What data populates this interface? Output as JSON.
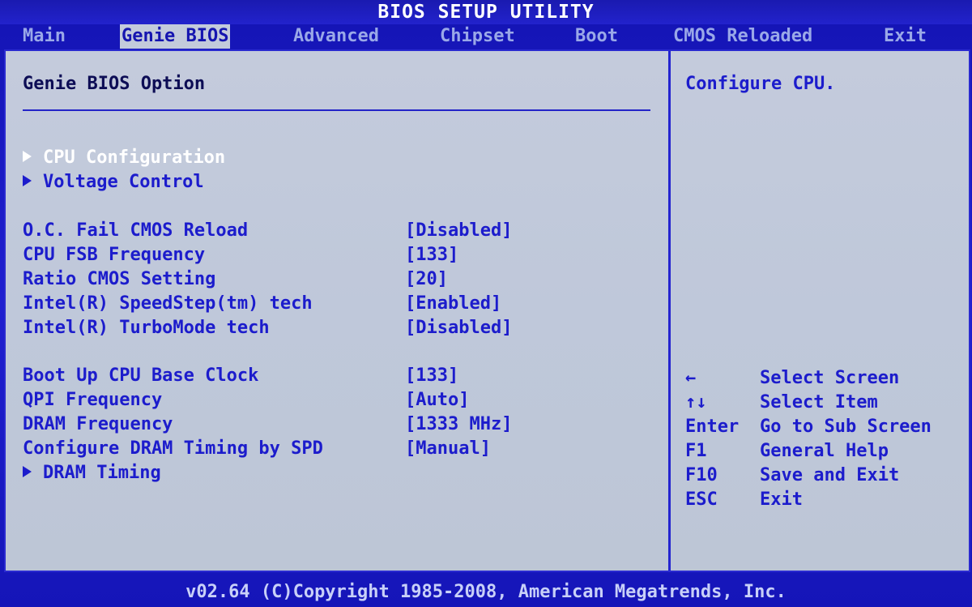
{
  "title": "BIOS SETUP UTILITY",
  "tabs": [
    {
      "label": "Main",
      "active": false
    },
    {
      "label": "Genie BIOS",
      "active": true
    },
    {
      "label": "Advanced",
      "active": false
    },
    {
      "label": "Chipset",
      "active": false
    },
    {
      "label": "Boot",
      "active": false
    },
    {
      "label": "CMOS Reloaded",
      "active": false
    },
    {
      "label": "Exit",
      "active": false
    }
  ],
  "section_title": "Genie BIOS Option",
  "submenus": [
    {
      "label": "CPU Configuration",
      "selected": true,
      "icon": "right-triangle-icon"
    },
    {
      "label": "Voltage Control",
      "selected": false,
      "icon": "right-triangle-icon"
    }
  ],
  "settings_group1": [
    {
      "label": "O.C. Fail CMOS Reload",
      "value": "[Disabled]"
    },
    {
      "label": "CPU FSB Frequency",
      "value": "[133]"
    },
    {
      "label": "Ratio CMOS Setting",
      "value": "[20]"
    },
    {
      "label": "Intel(R) SpeedStep(tm) tech",
      "value": "[Enabled]"
    },
    {
      "label": "Intel(R) TurboMode tech",
      "value": "[Disabled]"
    }
  ],
  "settings_group2": [
    {
      "label": "Boot Up CPU Base Clock",
      "value": "[133]"
    },
    {
      "label": "QPI Frequency",
      "value": "[Auto]"
    },
    {
      "label": "DRAM Frequency",
      "value": "[1333 MHz]"
    },
    {
      "label": "Configure DRAM Timing by SPD",
      "value": "[Manual]"
    }
  ],
  "submenu_dram": {
    "label": "DRAM Timing",
    "icon": "right-triangle-icon"
  },
  "help_text": "Configure CPU.",
  "key_legend": [
    {
      "key": "←",
      "desc": "Select Screen"
    },
    {
      "key": "↑↓",
      "desc": "Select Item"
    },
    {
      "key": "Enter",
      "desc": "Go to Sub Screen"
    },
    {
      "key": "F1",
      "desc": "General Help"
    },
    {
      "key": "F10",
      "desc": "Save and Exit"
    },
    {
      "key": "ESC",
      "desc": "Exit"
    }
  ],
  "footer": "v02.64 (C)Copyright 1985-2008, American Megatrends, Inc.",
  "colors": {
    "background_blue": "#1a1ac8",
    "panel_gray": "#c4cbdc",
    "text_blue": "#1c1ccc",
    "selected_white": "#ffffff"
  }
}
